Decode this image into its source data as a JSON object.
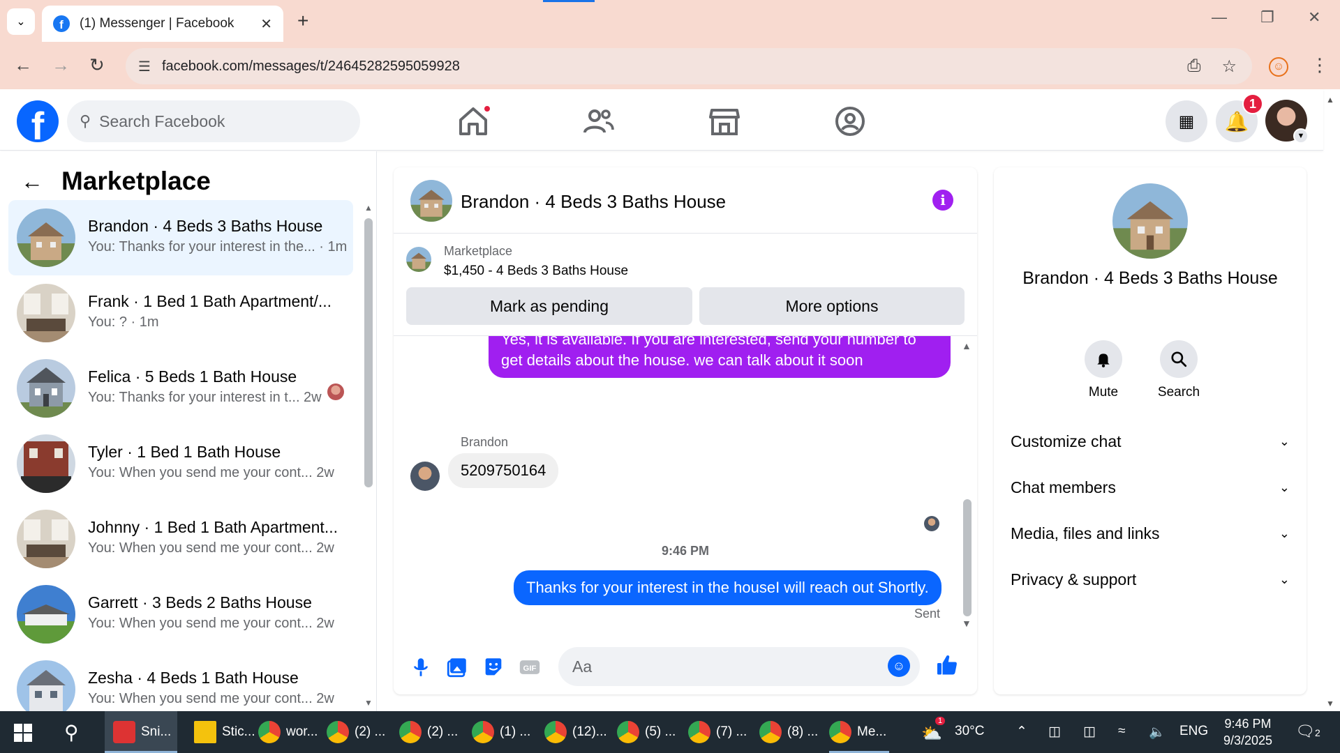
{
  "browser": {
    "tab_title": "(1) Messenger | Facebook",
    "url": "facebook.com/messages/t/24645282595059928",
    "new_tab_icon": "plus-icon"
  },
  "header": {
    "search_placeholder": "Search Facebook",
    "notification_count": "1",
    "nav": [
      "home-icon",
      "friends-icon",
      "marketplace-icon",
      "groups-icon"
    ]
  },
  "sidebar": {
    "title": "Marketplace",
    "conversations": [
      {
        "name": "Brandon · 4 Beds 3 Baths House",
        "preview": "You: Thanks for your interest in the... · 1m",
        "active": true
      },
      {
        "name": "Frank · 1 Bed 1 Bath Apartment/...",
        "preview": "You: ? · 1m"
      },
      {
        "name": "Felica · 5 Beds 1 Bath House",
        "preview": "You: Thanks for your interest in t... 2w"
      },
      {
        "name": "Tyler · 1 Bed 1 Bath House",
        "preview": "You: When you send me your cont...    2w"
      },
      {
        "name": "Johnny · 1 Bed 1 Bath Apartment...",
        "preview": "You: When you send me your cont...    2w"
      },
      {
        "name": "Garrett · 3 Beds 2 Baths House",
        "preview": "You: When you send me your cont...    2w"
      },
      {
        "name": "Zesha · 4 Beds 1 Bath House",
        "preview": "You: When you send me your cont...    2w"
      }
    ]
  },
  "chat": {
    "title": "Brandon · 4 Beds 3 Baths House",
    "listing": {
      "label": "Marketplace",
      "price_title": "$1,450 - 4 Beds 3 Baths House",
      "mark_pending": "Mark as pending",
      "more_options": "More options"
    },
    "messages": {
      "out_1_line1": "Yes, it is available. If you are interested, send your number to",
      "out_1_line2": "get details about the house. we can talk about it soon",
      "sender": "Brandon",
      "in_1": "5209750164",
      "time": "9:46 PM",
      "out_2": "Thanks for your interest in the houseI will reach out Shortly.",
      "status": "Sent"
    },
    "composer_placeholder": "Aa"
  },
  "details": {
    "name": "Brandon · 4 Beds 3 Baths House",
    "mute": "Mute",
    "search": "Search",
    "sections": [
      "Customize chat",
      "Chat members",
      "Media, files and links",
      "Privacy & support"
    ]
  },
  "taskbar": {
    "items": [
      "Sni...",
      "Stic...",
      "wor...",
      "(2) ...",
      "(2) ...",
      "(1) ...",
      "(12)...",
      "(5) ...",
      "(7) ...",
      "(8) ...",
      "Me..."
    ],
    "weather": "30°C",
    "lang": "ENG",
    "time": "9:46 PM",
    "date": "9/3/2025",
    "notif_count": "2",
    "weather_badge": "1"
  },
  "colors": {
    "chrome": "#f8dad0",
    "fb_blue": "#0866ff",
    "purple_bubble": "#a01ff0",
    "active_conv": "#ebf5ff"
  }
}
